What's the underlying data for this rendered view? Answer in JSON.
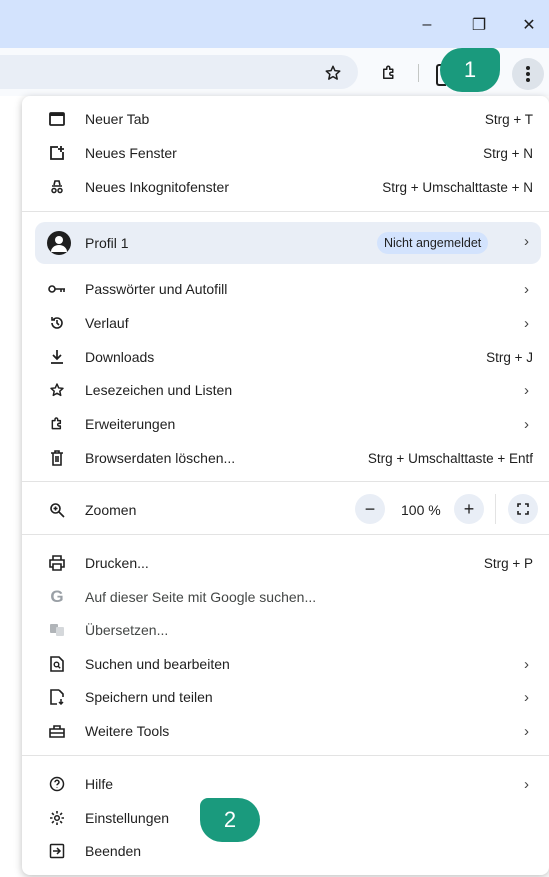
{
  "window": {
    "minimize_glyph": "–",
    "restore_glyph": "❐",
    "close_glyph": "✕"
  },
  "badges": {
    "one": "1",
    "two": "2"
  },
  "menu": {
    "new_tab": {
      "label": "Neuer Tab",
      "shortcut": "Strg + T"
    },
    "new_window": {
      "label": "Neues Fenster",
      "shortcut": "Strg + N"
    },
    "incognito": {
      "label": "Neues Inkognitofenster",
      "shortcut": "Strg + Umschalttaste + N"
    },
    "profile": {
      "label": "Profil 1",
      "status": "Nicht angemeldet"
    },
    "passwords": {
      "label": "Passwörter und Autofill"
    },
    "history": {
      "label": "Verlauf"
    },
    "downloads": {
      "label": "Downloads",
      "shortcut": "Strg + J"
    },
    "bookmarks": {
      "label": "Lesezeichen und Listen"
    },
    "extensions": {
      "label": "Erweiterungen"
    },
    "clear_data": {
      "label": "Browserdaten löschen...",
      "shortcut": "Strg + Umschalttaste + Entf"
    },
    "zoom": {
      "label": "Zoomen",
      "value": "100 %",
      "minus": "−",
      "plus": "+"
    },
    "print": {
      "label": "Drucken...",
      "shortcut": "Strg + P"
    },
    "google_search": {
      "label": "Auf dieser Seite mit Google suchen..."
    },
    "translate": {
      "label": "Übersetzen..."
    },
    "search_edit": {
      "label": "Suchen und bearbeiten"
    },
    "save_share": {
      "label": "Speichern und teilen"
    },
    "more_tools": {
      "label": "Weitere Tools"
    },
    "help": {
      "label": "Hilfe"
    },
    "settings": {
      "label": "Einstellungen"
    },
    "exit": {
      "label": "Beenden"
    }
  },
  "colors": {
    "accent": "#1a9a7d",
    "titlebar": "#d3e3fd",
    "profile_bg": "#e9eef6"
  }
}
